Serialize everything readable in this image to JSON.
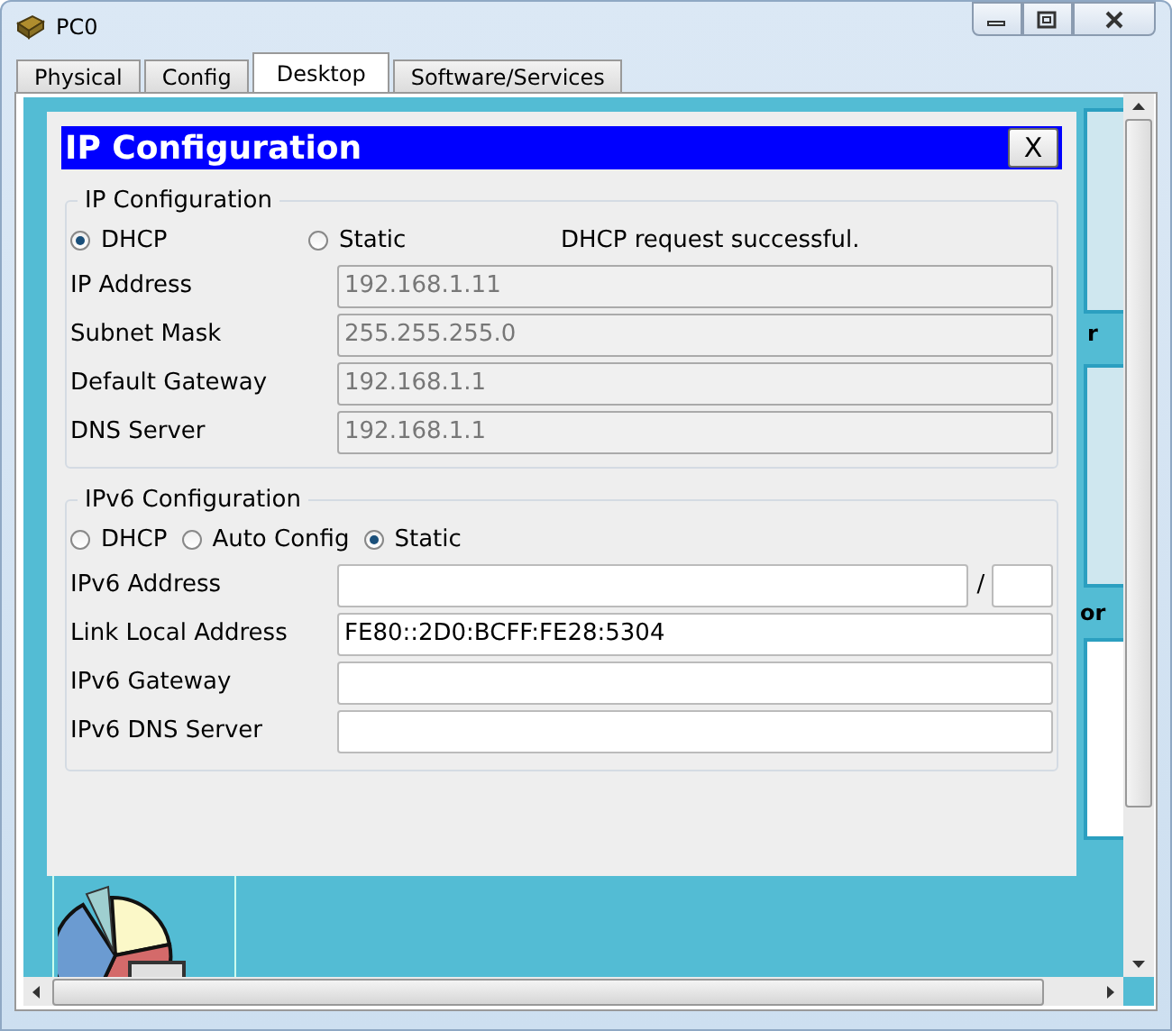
{
  "window": {
    "title": "PC0"
  },
  "tabs": [
    {
      "label": "Physical",
      "selected": false
    },
    {
      "label": "Config",
      "selected": false
    },
    {
      "label": "Desktop",
      "selected": true
    },
    {
      "label": "Software/Services",
      "selected": false
    }
  ],
  "background_fragments": [
    "r",
    "or"
  ],
  "dialog": {
    "title": "IP Configuration",
    "close": "X",
    "ipv4": {
      "legend": "IP Configuration",
      "modes": [
        {
          "label": "DHCP",
          "selected": true
        },
        {
          "label": "Static",
          "selected": false
        }
      ],
      "status": "DHCP request successful.",
      "fields": [
        {
          "label": "IP Address",
          "value": "192.168.1.11",
          "disabled": true
        },
        {
          "label": "Subnet Mask",
          "value": "255.255.255.0",
          "disabled": true
        },
        {
          "label": "Default Gateway",
          "value": "192.168.1.1",
          "disabled": true
        },
        {
          "label": "DNS Server",
          "value": "192.168.1.1",
          "disabled": true
        }
      ]
    },
    "ipv6": {
      "legend": "IPv6 Configuration",
      "modes": [
        {
          "label": "DHCP",
          "selected": false
        },
        {
          "label": "Auto Config",
          "selected": false
        },
        {
          "label": "Static",
          "selected": true
        }
      ],
      "fields": [
        {
          "label": "IPv6 Address",
          "kind": "prefixed",
          "separator": "/",
          "disabled": false
        },
        {
          "label": "Link Local Address",
          "value": "FE80::2D0:BCFF:FE28:5304",
          "disabled": false
        },
        {
          "label": "IPv6 Gateway",
          "disabled": false
        },
        {
          "label": "IPv6 DNS Server",
          "disabled": false
        }
      ]
    }
  }
}
